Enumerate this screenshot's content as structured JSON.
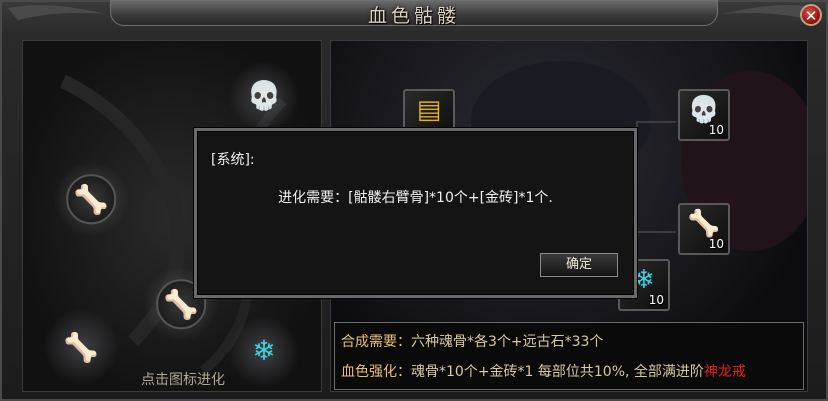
{
  "window": {
    "title": "血色骷髅",
    "close_icon": "close-icon"
  },
  "left_panel": {
    "hint": "点击图标进化",
    "nodes": [
      {
        "name": "skull-node",
        "icon": "skull-icon",
        "glyph": "💀"
      },
      {
        "name": "arm-bone-node",
        "icon": "arm-bone-icon",
        "glyph": "🦴"
      },
      {
        "name": "claw-node",
        "icon": "claw-icon",
        "glyph": "✋"
      },
      {
        "name": "rib-node",
        "icon": "rib-icon",
        "glyph": "🦴"
      },
      {
        "name": "leg-bone-node",
        "icon": "leg-bone-icon",
        "glyph": "🦴"
      },
      {
        "name": "wing-node",
        "icon": "wing-icon",
        "glyph": "❄"
      }
    ]
  },
  "right_panel": {
    "slots": [
      {
        "name": "gold-brick-slot",
        "icon": "gold-brick-icon",
        "glyph": "🧱",
        "count": ""
      },
      {
        "name": "skull-material-slot",
        "icon": "skull-icon",
        "glyph": "💀",
        "count": "10"
      },
      {
        "name": "arm-bone-material-slot",
        "icon": "arm-bone-icon",
        "glyph": "🦴",
        "count": "10"
      },
      {
        "name": "wing-material-slot",
        "icon": "wing-icon",
        "glyph": "❄",
        "count": "10"
      }
    ]
  },
  "description": {
    "line1_key": "合成需要：",
    "line1_value": "六种魂骨*各3个+远古石*33个",
    "line2_key": "血色强化：",
    "line2_value": "魂骨*10个+金砖*1  每部位共10%, 全部满进阶",
    "line2_highlight": "神龙戒"
  },
  "modal": {
    "header": "[系统]:",
    "message": "进化需要：[骷髅右臂骨]*10个+[金砖]*1个.",
    "ok_label": "确定"
  },
  "colors": {
    "accent_red": "#e02020",
    "text_gold": "#e8c070"
  }
}
